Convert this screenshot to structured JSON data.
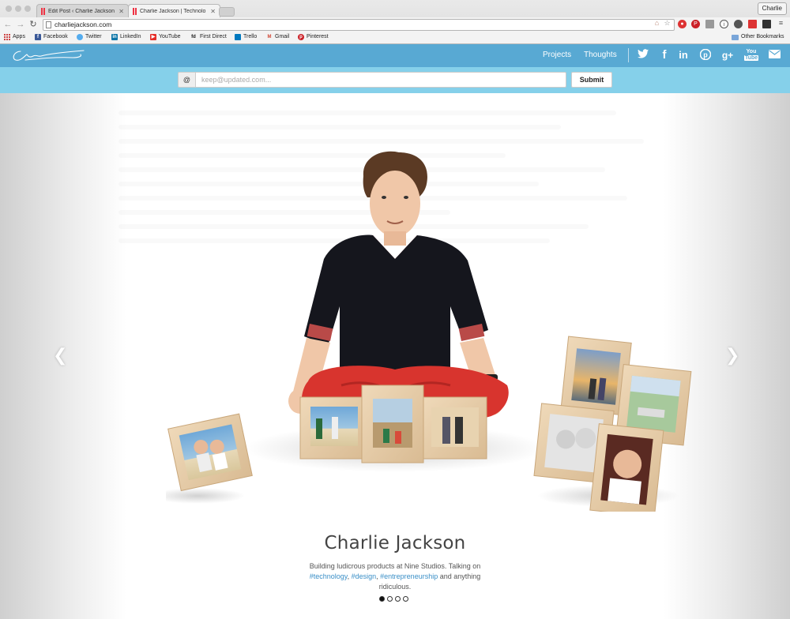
{
  "browser": {
    "tabs": [
      {
        "title": "Edit Post ‹ Charlie Jackson",
        "active": false
      },
      {
        "title": "Charlie Jackson | Technolo",
        "active": true
      }
    ],
    "profile": "Charlie",
    "url": "charliejackson.com",
    "bookmarks": [
      {
        "label": "Apps",
        "icon": "apps-grid-icon"
      },
      {
        "label": "Facebook",
        "icon": "facebook-icon",
        "color": "#3b5998"
      },
      {
        "label": "Twitter",
        "icon": "twitter-icon",
        "color": "#55acee"
      },
      {
        "label": "LinkedIn",
        "icon": "linkedin-icon",
        "color": "#0e76a8"
      },
      {
        "label": "YouTube",
        "icon": "youtube-icon",
        "color": "#e52d27"
      },
      {
        "label": "First Direct",
        "icon": "first-direct-icon"
      },
      {
        "label": "Trello",
        "icon": "trello-icon",
        "color": "#0079bf"
      },
      {
        "label": "Gmail",
        "icon": "gmail-icon",
        "color": "#d14836"
      },
      {
        "label": "Pinterest",
        "icon": "pinterest-icon",
        "color": "#cb2027"
      }
    ],
    "other_bookmarks": "Other Bookmarks"
  },
  "site": {
    "nav": {
      "projects": "Projects",
      "thoughts": "Thoughts"
    },
    "social": [
      "twitter-icon",
      "facebook-icon",
      "linkedin-icon",
      "pinterest-icon",
      "google-plus-icon",
      "youtube-icon",
      "email-icon"
    ],
    "signup": {
      "at": "@",
      "placeholder": "keep@updated.com...",
      "submit": "Submit"
    },
    "hero": {
      "name": "Charlie Jackson",
      "bio_prefix": "Building ludicrous products at Nine Studios. Talking on",
      "tags": [
        "#technology",
        "#design",
        "#entrepreneurship"
      ],
      "bio_suffix": "and anything ridiculous.",
      "slides": 4,
      "active_slide": 0
    },
    "colors": {
      "header": "#58a9d3",
      "signup_bar": "#85d0ea",
      "tag_link": "#3a8fc7"
    }
  }
}
